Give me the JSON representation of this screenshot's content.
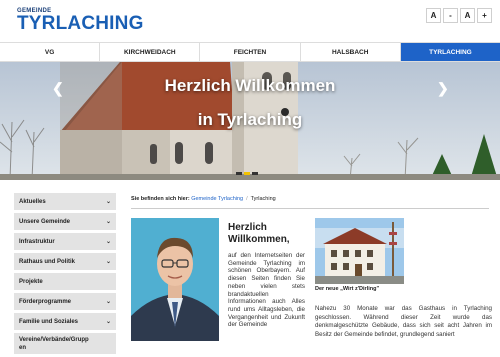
{
  "header": {
    "logo_top": "GEMEINDE",
    "logo_main": "TYRLACHING",
    "font_buttons": [
      "A",
      "-",
      "A",
      "+"
    ]
  },
  "nav": {
    "items": [
      "VG",
      "KIRCHWEIDACH",
      "FEICHTEN",
      "HALSBACH",
      "TYRLACHING"
    ],
    "active_index": 4,
    "accent": "#1e63c8"
  },
  "hero": {
    "title_line1": "Herzlich Willkommen",
    "title_line2": "in Tyrlaching",
    "slides": 3,
    "active_slide": 1
  },
  "sidebar": {
    "items": [
      {
        "label": "Aktuelles",
        "expandable": true
      },
      {
        "label": "Unsere Gemeinde",
        "expandable": true
      },
      {
        "label": "Infrastruktur",
        "expandable": true
      },
      {
        "label": "Rathaus und Politik",
        "expandable": true
      },
      {
        "label": "Projekte",
        "expandable": false
      },
      {
        "label": "Förderprogramme",
        "expandable": true
      },
      {
        "label": "Familie und Soziales",
        "expandable": true
      },
      {
        "label": "Vereine/Verbände/Grupp en",
        "expandable": false
      }
    ]
  },
  "breadcrumb": {
    "prefix": "Sie befinden sich hier:",
    "link": "Gemeinde Tyrlaching",
    "separator": "/",
    "current": "Tyrlaching"
  },
  "welcome": {
    "heading": "Herzlich Willkommen,",
    "text": "auf den Internetseiten der Gemeinde Tyrlaching im schönen Oberbayern. Auf diesen Seiten finden Sie neben vielen stets brandaktuellen Informationen auch Alles rund ums Alltagsleben, die Vergangenheit und Zukunft der Gemeinde"
  },
  "inn": {
    "caption": "Der neue „Wirt z'Dirling\""
  },
  "main_text": "Nahezu 30 Monate war das Gasthaus in Tyrlaching geschlossen. Während dieser Zeit wurde das denkmalgeschützte Gebäude, dass sich seit acht Jahren im Besitz der Gemeinde befindet, grundlegend saniert"
}
